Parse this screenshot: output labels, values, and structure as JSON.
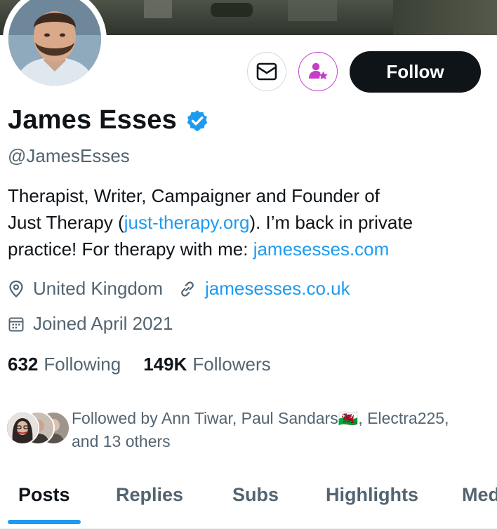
{
  "profile": {
    "name": "James Esses",
    "handle": "@JamesEsses",
    "verified": true,
    "bio": {
      "line1": "Therapist, Writer, Campaigner and Founder of",
      "line2_pre": "Just Therapy (",
      "line2_link": "just-therapy.org",
      "line2_post": "). I’m back in private",
      "line3_pre": "practice! For therapy with me: ",
      "line3_link": "jamesesses.com"
    },
    "location": "United Kingdom",
    "website": "jamesesses.co.uk",
    "joined": "Joined April 2021"
  },
  "actions": {
    "follow_label": "Follow",
    "message_icon": "envelope-icon",
    "subscribe_icon": "person-star-icon"
  },
  "stats": {
    "following_count": "632",
    "following_label": "Following",
    "followers_count": "149K",
    "followers_label": "Followers"
  },
  "followed_by": {
    "line1": "Followed by Ann Tiwar, Paul Sandars🏴󠁧󠁢󠁷󠁬󠁳󠁿, Electra225,",
    "line2": "and 13 others"
  },
  "tabs": [
    {
      "label": "Posts",
      "active": true
    },
    {
      "label": "Replies",
      "active": false
    },
    {
      "label": "Subs",
      "active": false
    },
    {
      "label": "Highlights",
      "active": false
    },
    {
      "label": "Med",
      "active": false
    }
  ],
  "colors": {
    "link": "#1d9bf0",
    "verified": "#1d9bf0",
    "subscribe_accent": "#c43fc7",
    "follow_button": "#0f1419"
  }
}
